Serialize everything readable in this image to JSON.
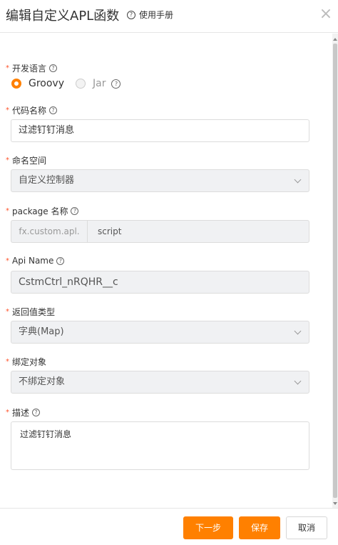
{
  "header": {
    "title": "编辑自定义APL函数",
    "help_label": "使用手册",
    "close_glyph": "×"
  },
  "form": {
    "language": {
      "label": "开发语言",
      "options": [
        {
          "label": "Groovy",
          "selected": true
        },
        {
          "label": "Jar",
          "selected": false
        }
      ]
    },
    "code_name": {
      "label": "代码名称",
      "value": "过滤钉钉消息"
    },
    "namespace": {
      "label": "命名空间",
      "value": "自定义控制器"
    },
    "package": {
      "label": "package 名称",
      "prefix": "fx.custom.apl.",
      "value": "script"
    },
    "api_name": {
      "label": "Api Name",
      "value": "CstmCtrl_nRQHR__c"
    },
    "return_type": {
      "label": "返回值类型",
      "value": "字典(Map)"
    },
    "bind_object": {
      "label": "绑定对象",
      "value": "不绑定对象"
    },
    "description": {
      "label": "描述",
      "value": "过滤钉钉消息"
    },
    "required_mark": "*"
  },
  "footer": {
    "next_label": "下一步",
    "save_label": "保存",
    "cancel_label": "取消"
  },
  "colors": {
    "accent": "#ff8000",
    "required": "#ff522a"
  }
}
